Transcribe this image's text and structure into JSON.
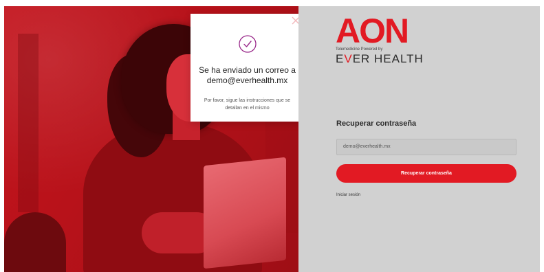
{
  "toast": {
    "title": "Se ha enviado un correo a demo@everhealth.mx",
    "subtitle": "Por favor, sigue las instrucciones que se detallan en el mismo",
    "icons": {
      "check": "check-circle-icon",
      "close": "close-icon"
    }
  },
  "brand": {
    "name": "AON",
    "tagline": "Telemedicine Powered by",
    "partner": {
      "prefix": "E",
      "highlight": "V",
      "suffix": "ER HEALTH"
    },
    "color": "#e21a23"
  },
  "form": {
    "heading": "Recuperar contraseña",
    "email_value": "demo@everhealth.mx",
    "submit_label": "Recuperar contraseña",
    "login_link": "Iniciar sesión"
  },
  "colors": {
    "accent": "#e21a23",
    "panel_bg": "#d1d1d1",
    "hero_tint": "#c3141d"
  }
}
